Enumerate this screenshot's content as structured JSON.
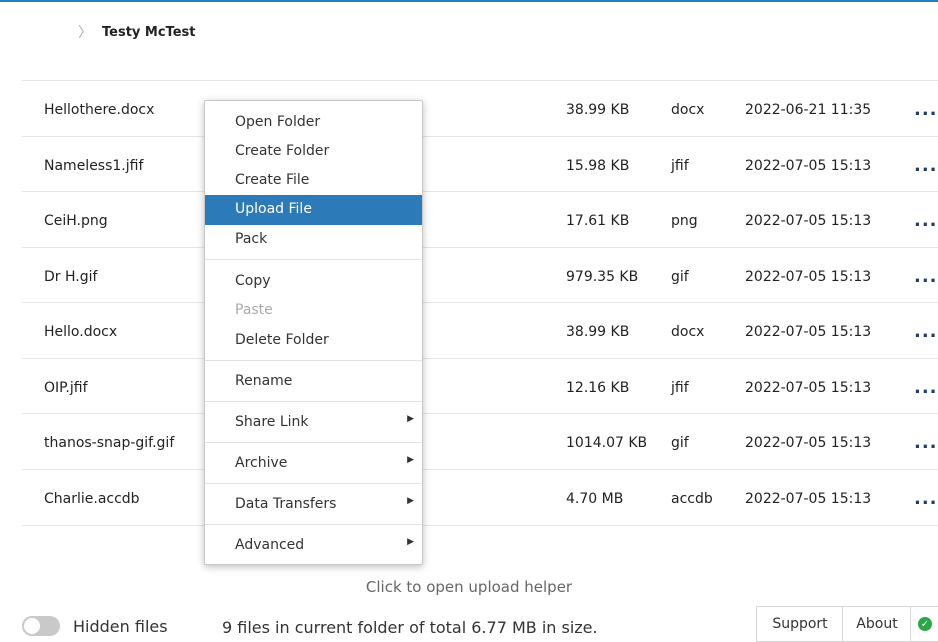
{
  "breadcrumb": {
    "folder": "Testy McTest",
    "separator": "〉"
  },
  "files": [
    {
      "name": "Hellothere.docx",
      "size": "38.99 KB",
      "type": "docx",
      "date": "2022-06-21 11:35"
    },
    {
      "name": "Nameless1.jfif",
      "size": "15.98 KB",
      "type": "jfif",
      "date": "2022-07-05 15:13"
    },
    {
      "name": "CeiH.png",
      "size": "17.61 KB",
      "type": "png",
      "date": "2022-07-05 15:13"
    },
    {
      "name": "Dr H.gif",
      "size": "979.35 KB",
      "type": "gif",
      "date": "2022-07-05 15:13"
    },
    {
      "name": "Hello.docx",
      "size": "38.99 KB",
      "type": "docx",
      "date": "2022-07-05 15:13"
    },
    {
      "name": "OIP.jfif",
      "size": "12.16 KB",
      "type": "jfif",
      "date": "2022-07-05 15:13"
    },
    {
      "name": "thanos-snap-gif.gif",
      "size": "1014.07 KB",
      "type": "gif",
      "date": "2022-07-05 15:13"
    },
    {
      "name": "Charlie.accdb",
      "size": "4.70 MB",
      "type": "accdb",
      "date": "2022-07-05 15:13"
    }
  ],
  "row_action": "...",
  "context_menu": {
    "items": [
      {
        "label": "Open Folder"
      },
      {
        "label": "Create Folder"
      },
      {
        "label": "Create File"
      },
      {
        "label": "Upload File",
        "active": true
      },
      {
        "label": "Pack"
      },
      {
        "label": "Copy"
      },
      {
        "label": "Paste",
        "disabled": true
      },
      {
        "label": "Delete Folder"
      },
      {
        "label": "Rename"
      },
      {
        "label": "Share Link",
        "submenu": true
      },
      {
        "label": "Archive",
        "submenu": true
      },
      {
        "label": "Data Transfers",
        "submenu": true
      },
      {
        "label": "Advanced",
        "submenu": true
      }
    ],
    "submenu_arrow": "▶"
  },
  "upload_helper": "Click to open upload helper",
  "footer": {
    "hidden_files_label": "Hidden files",
    "hidden_files_on": false,
    "summary": "9 files in current folder of total 6.77 MB in size.",
    "support": "Support",
    "about": "About",
    "status_icon": "check-icon",
    "status_glyph": "✓"
  },
  "colors": {
    "accent": "#1f7fc2",
    "active_menu": "#2d7ab8",
    "ok": "#2aa848"
  }
}
